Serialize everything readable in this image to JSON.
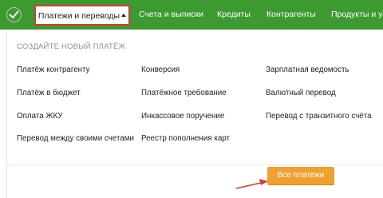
{
  "nav": {
    "items": [
      {
        "label": "Платежи и переводы"
      },
      {
        "label": "Счета и выписки"
      },
      {
        "label": "Кредиты"
      },
      {
        "label": "Контрагенты"
      },
      {
        "label": "Продукты и усл"
      }
    ]
  },
  "menu": {
    "section_title": "СОЗДАЙТЕ НОВЫЙ ПЛАТЁЖ",
    "col1": [
      "Платёж контрагенту",
      "Платёж в бюджет",
      "Оплата ЖКУ",
      "Перевод между своими счетами"
    ],
    "col2": [
      "Конверсия",
      "Платёжное требование",
      "Инкассовое поручение",
      "Реестр пополнения карт"
    ],
    "col3": [
      "Зарплатная ведомость",
      "Валютный перевод",
      "Перевод с транзитного счёта"
    ],
    "all_payments_button": "Все платежи"
  },
  "colors": {
    "navbar": "#3c9a30",
    "highlight": "#d93a2b",
    "button": "#f0a030"
  }
}
